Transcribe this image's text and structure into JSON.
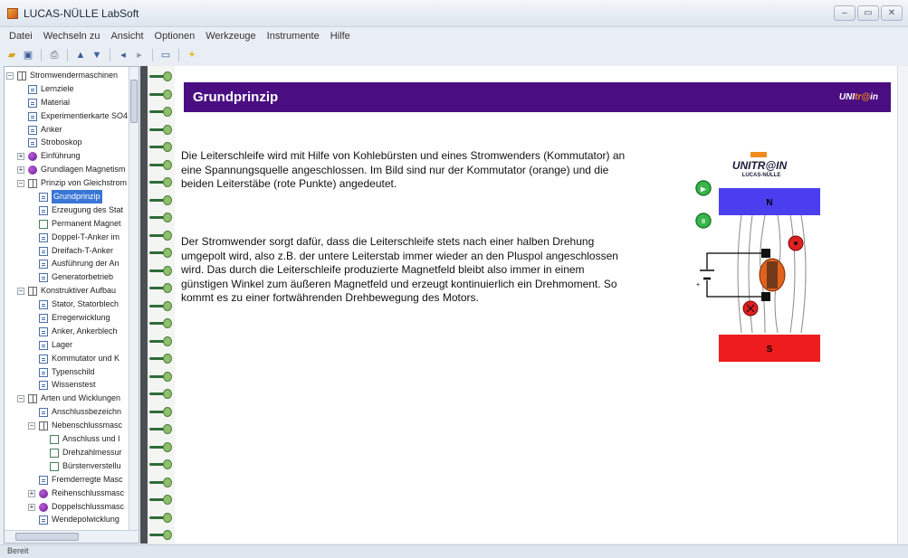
{
  "window": {
    "title": "LUCAS-NÜLLE LabSoft",
    "buttons": [
      "–",
      "▭",
      "✕"
    ]
  },
  "menu": [
    "Datei",
    "Wechseln zu",
    "Ansicht",
    "Optionen",
    "Werkzeuge",
    "Instrumente",
    "Hilfe"
  ],
  "toolbar": {
    "icons": [
      "open-icon",
      "save-icon",
      "print-icon",
      "up-icon",
      "down-icon",
      "back-icon",
      "forward-icon",
      "window-icon",
      "lightbulb-icon"
    ]
  },
  "tree": {
    "items": [
      {
        "label": "Stromwendermaschinen",
        "level": 0,
        "icon": "book",
        "expander": "−"
      },
      {
        "label": "Lernziele",
        "level": 1,
        "icon": "page"
      },
      {
        "label": "Material",
        "level": 1,
        "icon": "page"
      },
      {
        "label": "Experimentierkarte SO4",
        "level": 1,
        "icon": "page"
      },
      {
        "label": "Anker",
        "level": 1,
        "icon": "page"
      },
      {
        "label": "Stroboskop",
        "level": 1,
        "icon": "page"
      },
      {
        "label": "Einführung",
        "level": 1,
        "icon": "grape",
        "expander": "+"
      },
      {
        "label": "Grundlagen Magnetism",
        "level": 1,
        "icon": "grape",
        "expander": "+"
      },
      {
        "label": "Prinzip von Gleichstrom",
        "level": 1,
        "icon": "book",
        "expander": "−"
      },
      {
        "label": "Grundprinzip",
        "level": 2,
        "icon": "page",
        "selected": true
      },
      {
        "label": "Erzeugung des Stat",
        "level": 2,
        "icon": "page"
      },
      {
        "label": "Permanent Magnet",
        "level": 2,
        "icon": "pen"
      },
      {
        "label": "Doppel-T-Anker im",
        "level": 2,
        "icon": "page"
      },
      {
        "label": "Dreifach-T-Anker",
        "level": 2,
        "icon": "page"
      },
      {
        "label": "Ausführung der An",
        "level": 2,
        "icon": "page"
      },
      {
        "label": "Generatorbetrieb",
        "level": 2,
        "icon": "page"
      },
      {
        "label": "Konstruktiver Aufbau",
        "level": 1,
        "icon": "book",
        "expander": "−"
      },
      {
        "label": "Stator, Statorblech",
        "level": 2,
        "icon": "page"
      },
      {
        "label": "Erregerwicklung",
        "level": 2,
        "icon": "page"
      },
      {
        "label": "Anker, Ankerblech",
        "level": 2,
        "icon": "page"
      },
      {
        "label": "Lager",
        "level": 2,
        "icon": "page"
      },
      {
        "label": "Kommutator und K",
        "level": 2,
        "icon": "page"
      },
      {
        "label": "Typenschild",
        "level": 2,
        "icon": "page"
      },
      {
        "label": "Wissenstest",
        "level": 2,
        "icon": "page"
      },
      {
        "label": "Arten und Wicklungen",
        "level": 1,
        "icon": "book",
        "expander": "−"
      },
      {
        "label": "Anschlussbezeichn",
        "level": 2,
        "icon": "page"
      },
      {
        "label": "Nebenschlussmasc",
        "level": 2,
        "icon": "book",
        "expander": "−"
      },
      {
        "label": "Anschluss und I",
        "level": 3,
        "icon": "pen"
      },
      {
        "label": "Drehzahlmessur",
        "level": 3,
        "icon": "pen"
      },
      {
        "label": "Bürstenverstellu",
        "level": 3,
        "icon": "pen"
      },
      {
        "label": "Fremderregte Masc",
        "level": 2,
        "icon": "page"
      },
      {
        "label": "Reihenschlussmasc",
        "level": 2,
        "icon": "grape",
        "expander": "+"
      },
      {
        "label": "Doppelschlussmasc",
        "level": 2,
        "icon": "grape",
        "expander": "+"
      },
      {
        "label": "Wendepolwicklung",
        "level": 2,
        "icon": "page"
      }
    ]
  },
  "content": {
    "title": "Grundprinzip",
    "header_logo": {
      "prefix": "UNI",
      "highlight": "tr@",
      "suffix": "in"
    },
    "paragraph1": "Die Leiterschleife wird mit Hilfe von Kohlebürsten und eines Stromwenders (Kommutator) an eine Spannungsquelle angeschlossen. Im Bild sind nur der Kommutator (orange) und die beiden Leiterstäbe (rote Punkte) angedeutet.",
    "paragraph2": "Der Stromwender sorgt dafür, dass die Leiterschleife stets nach einer halben Drehung  umgepolt wird, also z.B. der untere Leiterstab immer wieder an den Pluspol angeschlossen wird. Das durch die Leiterschleife produzierte Magnetfeld bleibt also immer in einem günstigen Winkel zum äußeren Magnetfeld und erzeugt kontinuierlich ein Drehmoment. So kommt es zu einer fortwährenden Drehbewegung des Motors."
  },
  "diagram": {
    "logo_main": "UNITR@IN",
    "logo_sub": "LUCAS-NÜLLE",
    "north_label": "N",
    "south_label": "S",
    "button_play": "▶",
    "button_pause": "II",
    "colors": {
      "magnet_north": "#4a3ef0",
      "magnet_south": "#ee1c1c",
      "commutator": "#e0621c",
      "conductor": "#e02020",
      "button_green": "#39b54a"
    }
  },
  "status": {
    "text": "Bereit"
  },
  "colors": {
    "header_bg": "#4a0e82",
    "selection": "#3a76d6",
    "binding_ring": "#2f6b38"
  }
}
